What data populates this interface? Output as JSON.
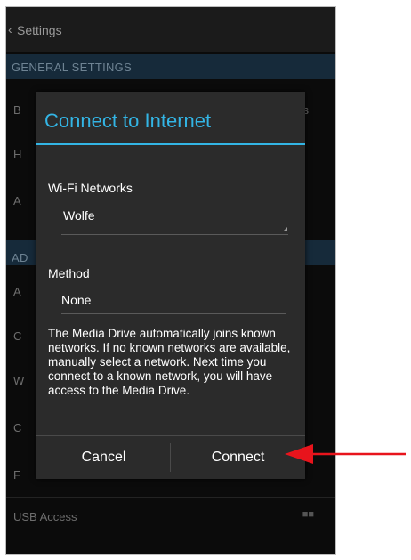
{
  "background": {
    "back_label": "Settings",
    "general_section": "GENERAL SETTINGS",
    "rows_general": [
      "B",
      "H",
      "A"
    ],
    "general_row_right": "s",
    "advanced_section": "AD",
    "rows_advanced": [
      "A",
      "C",
      "W",
      "C",
      "F"
    ],
    "usb_label": "USB Access"
  },
  "dialog": {
    "title": "Connect to Internet",
    "wifi_label": "Wi-Fi Networks",
    "wifi_value": "Wolfe",
    "method_label": "Method",
    "method_value": "None",
    "description": "The Media Drive automatically joins known networks. If no known networks are available, manually select a network. Next time you connect to a known network, you will have access to the Media Drive.",
    "cancel_label": "Cancel",
    "connect_label": "Connect"
  },
  "colors": {
    "accent": "#33b5e5",
    "arrow": "#e8141c"
  }
}
